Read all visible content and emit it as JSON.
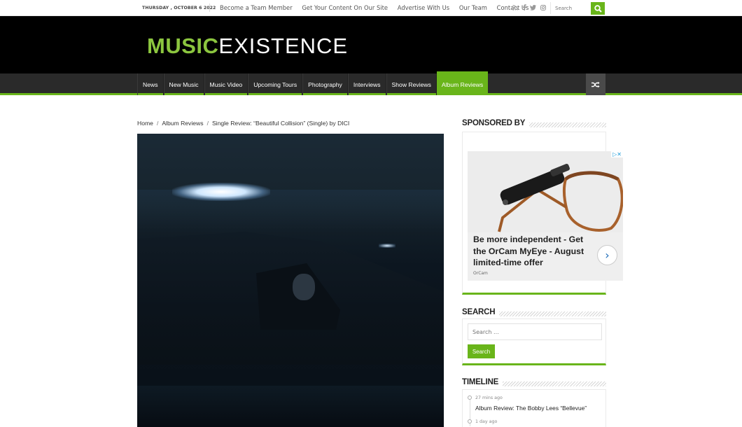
{
  "topbar": {
    "date": "THURSDAY , OCTOBER 6 2022",
    "links": [
      "Become a Team Member",
      "Get Your Content On Our Site",
      "Advertise With Us",
      "Our Team",
      "Contact Us"
    ],
    "social_icons": [
      "rss-icon",
      "facebook-icon",
      "twitter-icon",
      "instagram-icon"
    ],
    "search_placeholder": "Search"
  },
  "header": {
    "logo_part1": "MUSIC",
    "logo_part2": "EXISTENCE"
  },
  "nav": {
    "items": [
      "News",
      "New Music",
      "Music Video",
      "Upcoming Tours",
      "Photography",
      "Interviews",
      "Show Reviews",
      "Album Reviews"
    ],
    "active": "Album Reviews"
  },
  "breadcrumb": {
    "items": [
      "Home",
      "Album Reviews",
      "Single Review: “Beautiful Collision” (Single) by DICI"
    ],
    "separator": "/"
  },
  "sidebar": {
    "sponsored_title": "SPONSORED BY",
    "ad": {
      "headline": "Be more independent - Get the OrCam MyEye - August limited-time offer",
      "brand": "OrCam"
    },
    "search_title": "SEARCH",
    "search_placeholder": "Search ...",
    "search_button": "Search",
    "timeline_title": "TIMELINE",
    "timeline": [
      {
        "time": "27 mins ago",
        "title": "Album Review: The Bobby Lees “Bellevue”"
      },
      {
        "time": "1 day ago",
        "title": ""
      }
    ]
  },
  "colors": {
    "accent": "#69b51a",
    "logo_green": "#8cc63f",
    "header_bg": "#000000",
    "nav_bg": "#2a2a2a"
  }
}
